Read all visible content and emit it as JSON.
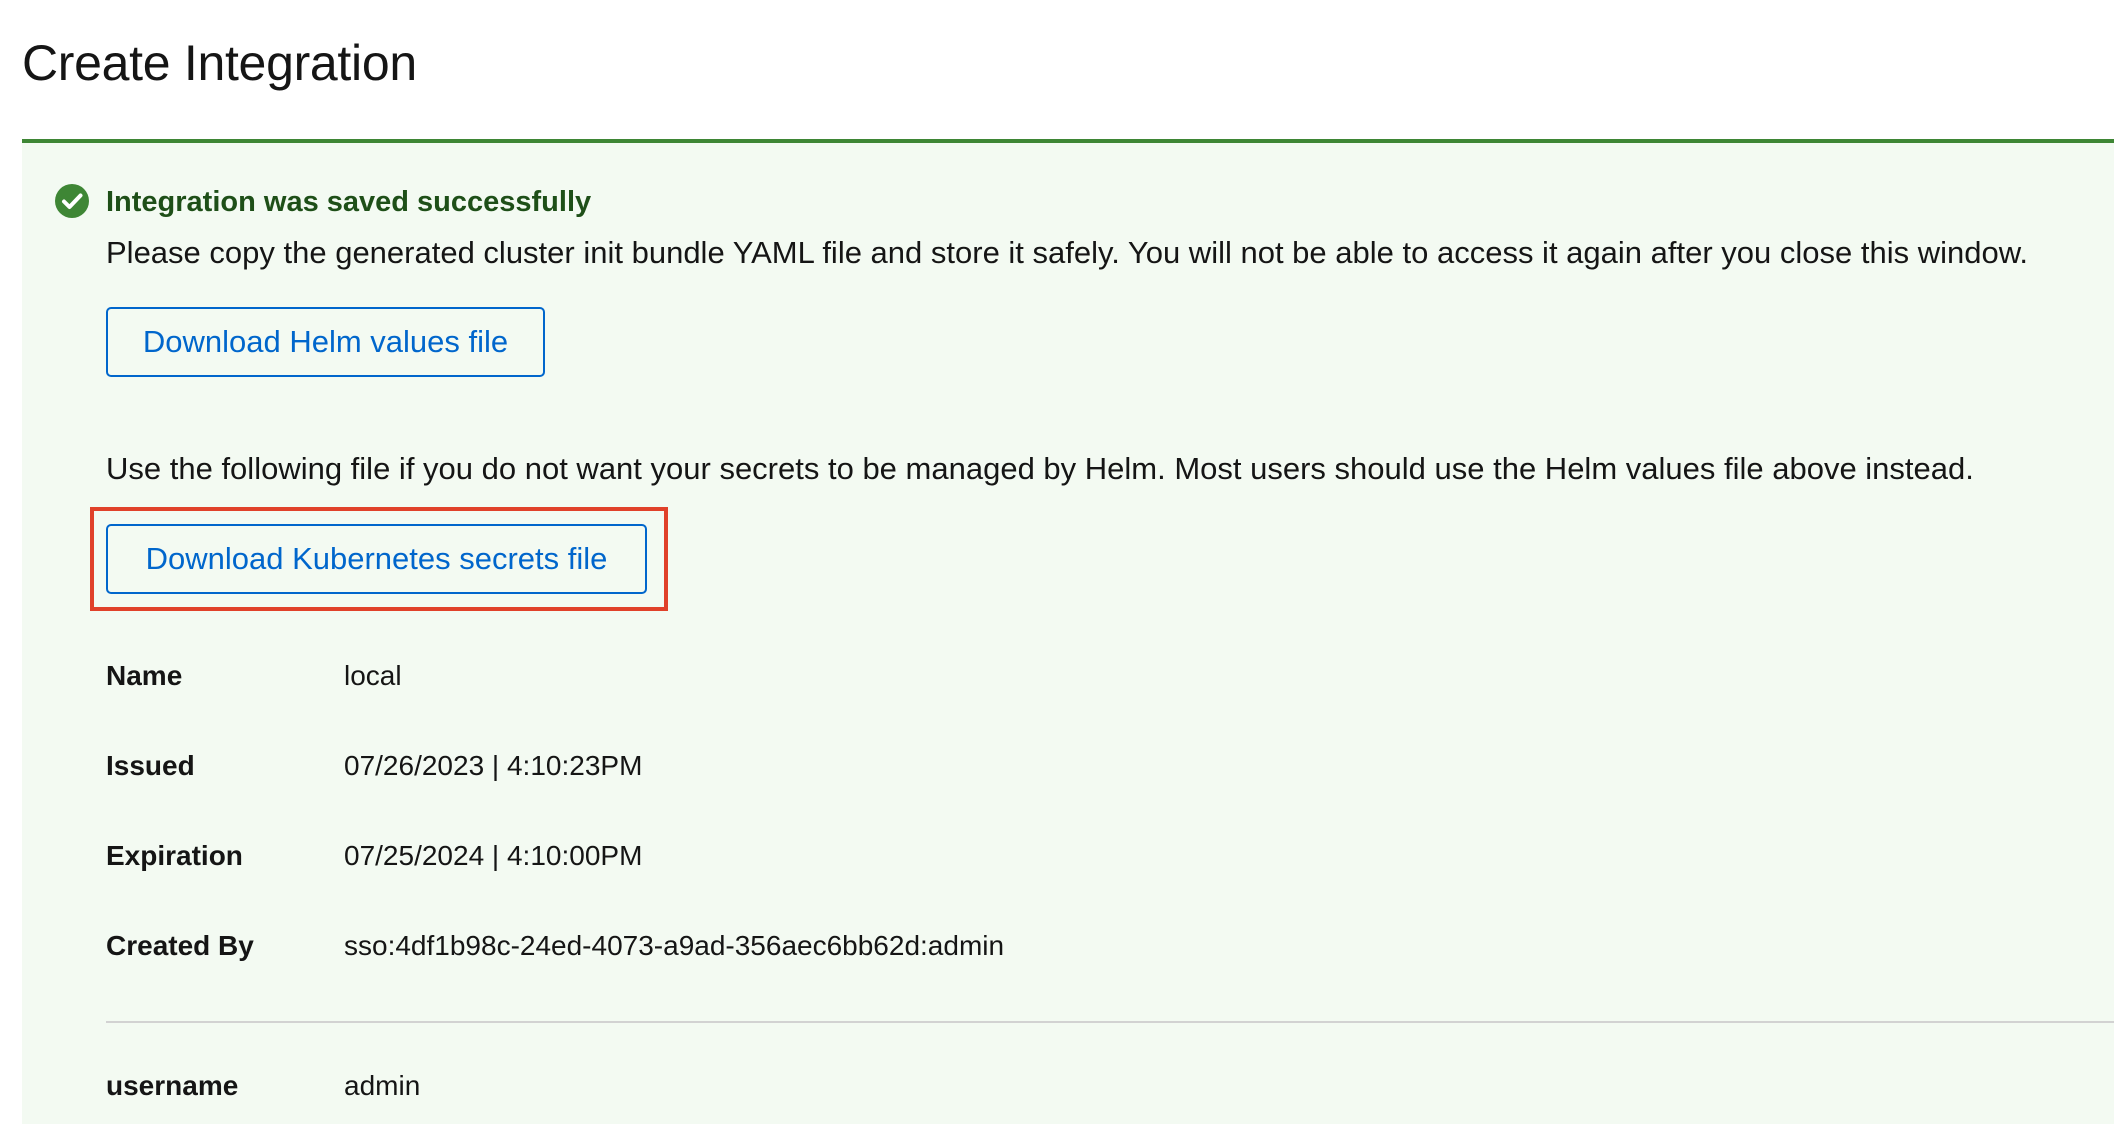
{
  "page": {
    "title": "Create Integration"
  },
  "alert": {
    "status": "success",
    "icon": "check-circle-icon",
    "accent_color": "#3e8635",
    "background_color": "#f3faf2",
    "title": "Integration was saved successfully",
    "intro_text": "Please copy the generated cluster init bundle YAML file and store it safely. You will not be able to access it again after you close this window.",
    "helm_button_label": "Download Helm values file",
    "note_text": "Use the following file if you do not want your secrets to be managed by Helm. Most users should use the Helm values file above instead.",
    "k8s_button_label": "Download Kubernetes secrets file",
    "highlight_color": "#e0412a"
  },
  "details": [
    {
      "term": "Name",
      "value": "local"
    },
    {
      "term": "Issued",
      "value": "07/26/2023 | 4:10:23PM"
    },
    {
      "term": "Expiration",
      "value": "07/25/2024 | 4:10:00PM"
    },
    {
      "term": "Created By",
      "value": "sso:4df1b98c-24ed-4073-a9ad-356aec6bb62d:admin"
    }
  ],
  "details_extra": [
    {
      "term": "username",
      "value": "admin"
    }
  ]
}
